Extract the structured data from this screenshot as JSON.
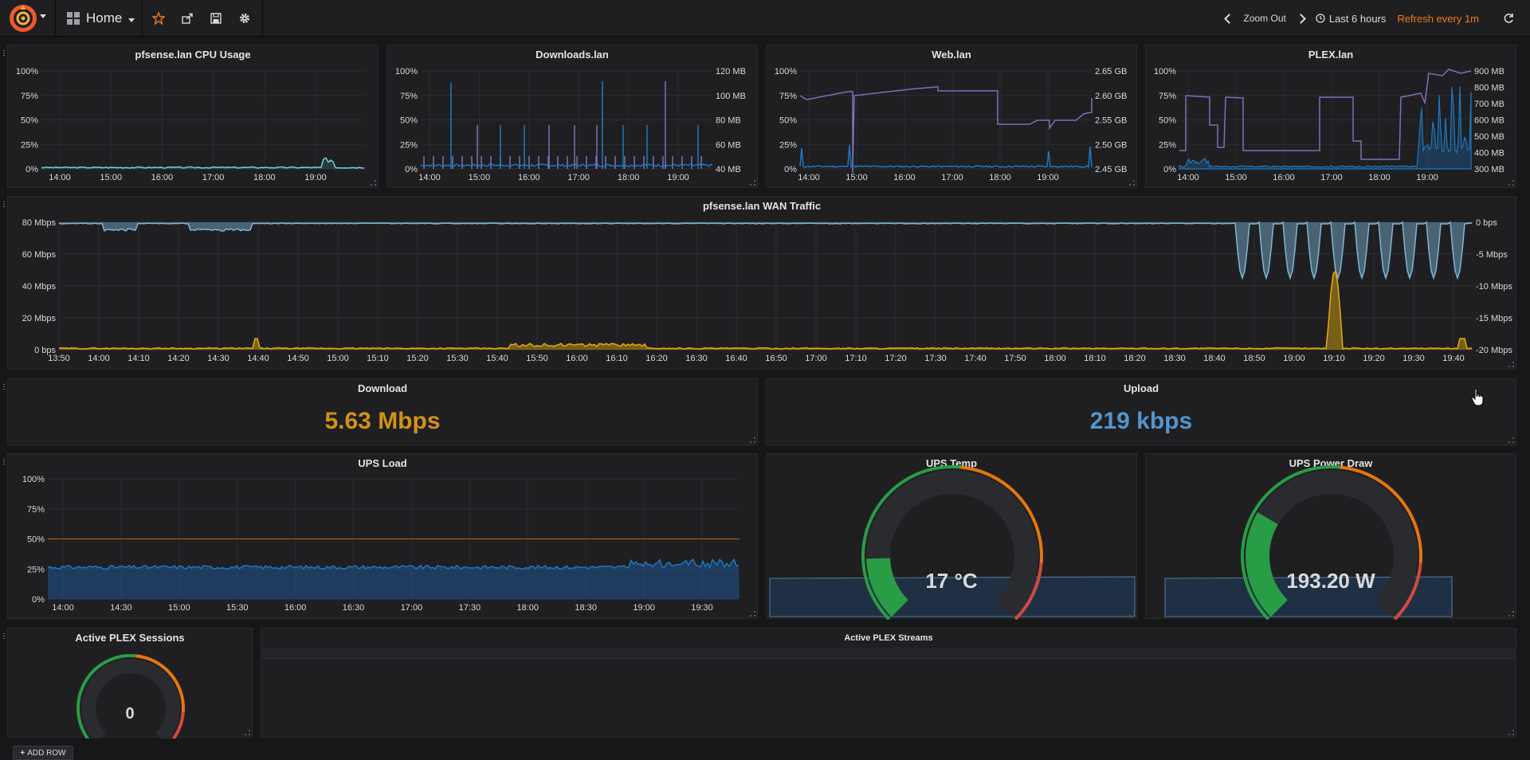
{
  "nav": {
    "home_label": "Home",
    "zoom_out": "Zoom Out",
    "time_range": "Last 6 hours",
    "refresh": "Refresh every 1m",
    "icons": [
      "grafana-logo-icon",
      "dashboard-grid-icon",
      "star-icon",
      "share-icon",
      "save-icon",
      "settings-gear-icon",
      "chevron-left-icon",
      "chevron-right-icon",
      "clock-icon",
      "refresh-icon"
    ]
  },
  "colors": {
    "blue": "#1f78c1",
    "lightblue": "#6ed0e0",
    "purple": "#806eb7",
    "yellow": "#e5ac0e",
    "wanblue": "#7eb5d6",
    "orange_stat": "#d19216",
    "blue_stat": "#5195ce",
    "gauge_green": "#299c46",
    "gauge_orange": "#e5760e",
    "gauge_red": "#d44a3a"
  },
  "panels": {
    "cpu": {
      "title": "pfsense.lan CPU Usage",
      "y_ticks": [
        "100%",
        "75%",
        "50%",
        "25%",
        "0%"
      ],
      "x_ticks": [
        "14:00",
        "15:00",
        "16:00",
        "17:00",
        "18:00",
        "19:00"
      ]
    },
    "downloads": {
      "title": "Downloads.lan",
      "y_ticks": [
        "100%",
        "75%",
        "50%",
        "25%",
        "0%"
      ],
      "y2_ticks": [
        "120 MB",
        "100 MB",
        "80 MB",
        "60 MB",
        "40 MB"
      ],
      "x_ticks": [
        "14:00",
        "15:00",
        "16:00",
        "17:00",
        "18:00",
        "19:00"
      ]
    },
    "web": {
      "title": "Web.lan",
      "y_ticks": [
        "100%",
        "75%",
        "50%",
        "25%",
        "0%"
      ],
      "y2_ticks": [
        "2.65 GB",
        "2.60 GB",
        "2.55 GB",
        "2.50 GB",
        "2.45 GB"
      ],
      "x_ticks": [
        "14:00",
        "15:00",
        "16:00",
        "17:00",
        "18:00",
        "19:00"
      ]
    },
    "plex": {
      "title": "PLEX.lan",
      "y_ticks": [
        "100%",
        "75%",
        "50%",
        "25%",
        "0%"
      ],
      "y2_ticks": [
        "900 MB",
        "800 MB",
        "700 MB",
        "600 MB",
        "500 MB",
        "400 MB",
        "300 MB"
      ],
      "x_ticks": [
        "14:00",
        "15:00",
        "16:00",
        "17:00",
        "18:00",
        "19:00"
      ]
    },
    "wan": {
      "title": "pfsense.lan WAN Traffic",
      "y_ticks": [
        "80 Mbps",
        "60 Mbps",
        "40 Mbps",
        "20 Mbps",
        "0 bps"
      ],
      "y2_ticks": [
        "0 bps",
        "-5 Mbps",
        "-10 Mbps",
        "-15 Mbps",
        "-20 Mbps"
      ],
      "x_ticks": [
        "13:50",
        "14:00",
        "14:10",
        "14:20",
        "14:30",
        "14:40",
        "14:50",
        "15:00",
        "15:10",
        "15:20",
        "15:30",
        "15:40",
        "15:50",
        "16:00",
        "16:10",
        "16:20",
        "16:30",
        "16:40",
        "16:50",
        "17:00",
        "17:10",
        "17:20",
        "17:30",
        "17:40",
        "17:50",
        "18:00",
        "18:10",
        "18:20",
        "18:30",
        "18:40",
        "18:50",
        "19:00",
        "19:10",
        "19:20",
        "19:30",
        "19:40"
      ]
    },
    "download": {
      "title": "Download",
      "value": "5.63 Mbps"
    },
    "upload": {
      "title": "Upload",
      "value": "219 kbps"
    },
    "ups_load": {
      "title": "UPS Load",
      "y_ticks": [
        "100%",
        "75%",
        "50%",
        "25%",
        "0%"
      ],
      "x_ticks": [
        "14:00",
        "14:30",
        "15:00",
        "15:30",
        "16:00",
        "16:30",
        "17:00",
        "17:30",
        "18:00",
        "18:30",
        "19:00",
        "19:30"
      ]
    },
    "ups_temp": {
      "title": "UPS Temp",
      "value": "17 °C"
    },
    "ups_power": {
      "title": "UPS Power Draw",
      "value": "193.20 W"
    },
    "plex_sessions": {
      "title": "Active PLEX Sessions",
      "value": "0"
    },
    "plex_streams": {
      "title": "Active PLEX Streams"
    }
  },
  "add_row": "ADD ROW"
}
